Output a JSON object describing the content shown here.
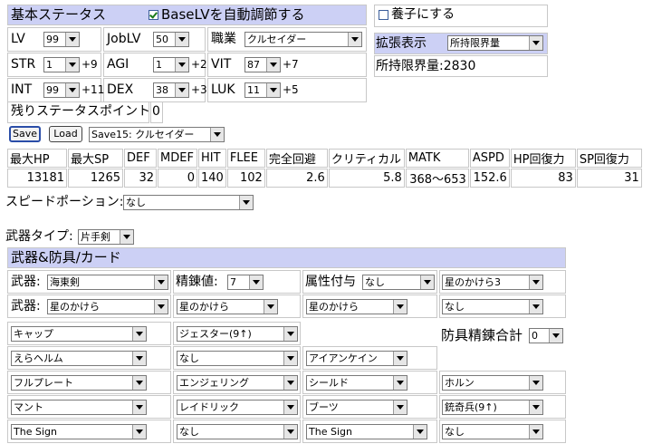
{
  "basic": {
    "title": "基本ステータス",
    "auto_label": "BaseLVを自動調節する",
    "lv_label": "LV",
    "lv": "99",
    "joblv_label": "JobLV",
    "joblv": "50",
    "job_label": "職業",
    "job": "クルセイダー",
    "stats": [
      {
        "label": "STR",
        "value": "1",
        "bonus": "+9"
      },
      {
        "label": "AGI",
        "value": "1",
        "bonus": "+2"
      },
      {
        "label": "VIT",
        "value": "87",
        "bonus": "+7"
      },
      {
        "label": "INT",
        "value": "99",
        "bonus": "+11"
      },
      {
        "label": "DEX",
        "value": "38",
        "bonus": "+3"
      },
      {
        "label": "LUK",
        "value": "11",
        "bonus": "+5"
      }
    ],
    "points_label": "残りステータスポイント",
    "points": "0"
  },
  "adopt_label": "養子にする",
  "ext": {
    "label": "拡張表示",
    "select": "所持限界量",
    "capacity": "所持限界量:2830"
  },
  "save": {
    "save_label": "Save",
    "load_label": "Load",
    "slot": "Save15: クルセイダー"
  },
  "derived": {
    "headers": [
      "最大HP",
      "最大SP",
      "DEF",
      "MDEF",
      "HIT",
      "FLEE",
      "完全回避",
      "クリティカル",
      "MATK",
      "ASPD",
      "HP回復力",
      "SP回復力"
    ],
    "values": [
      "13181",
      "1265",
      "32",
      "0",
      "140",
      "102",
      "2.6",
      "5.8",
      "368〜653",
      "152.6",
      "83",
      "31"
    ]
  },
  "speed_potion": {
    "label": "スピードポーション:",
    "value": "なし"
  },
  "weapon_type": {
    "label": "武器タイプ:",
    "value": "片手剣"
  },
  "equip": {
    "title": "武器&防具/カード",
    "weapon_label": "武器:",
    "weapon1": "海東剣",
    "refine_label": "精錬値:",
    "refine": "7",
    "element_label": "属性付与",
    "element": "なし",
    "card_w1_4": "星のかけら3",
    "weapon2": "星のかけら",
    "card_w2_2": "星のかけら",
    "card_w2_3": "星のかけら",
    "card_w2_4": "なし",
    "armor_refine_label": "防具精錬合計",
    "armor_refine": "0",
    "rows": [
      [
        "キャップ",
        "ジェスター(9↑)",
        "",
        ""
      ],
      [
        "えらヘルム",
        "なし",
        "アイアンケイン",
        ""
      ],
      [
        "フルプレート",
        "エンジェリング",
        "シールド",
        "ホルン"
      ],
      [
        "マント",
        "レイドリック",
        "ブーツ",
        "銃奇兵(9↑)"
      ],
      [
        "The Sign",
        "なし",
        "The Sign",
        "なし"
      ]
    ]
  }
}
